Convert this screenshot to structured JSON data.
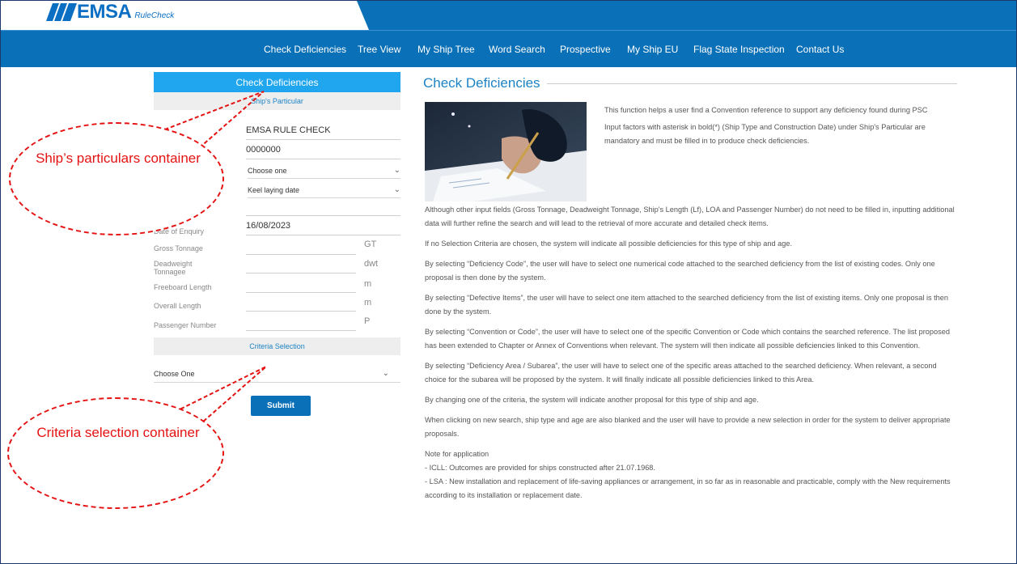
{
  "logo": {
    "text": "EMSA",
    "sub": "RuleCheck"
  },
  "nav": {
    "items": [
      "Check Deficiencies",
      "Tree View",
      "My Ship Tree",
      "Word Search",
      "Prospective",
      "My Ship EU",
      "Flag State Inspection",
      "Contact Us"
    ]
  },
  "left_panel": {
    "title": "Check Deficiencies",
    "ship_particular_header": "Ship's Particular",
    "ship_name": "EMSA RULE CHECK",
    "imo": "0000000",
    "ship_type_placeholder": "Choose one",
    "keel_placeholder": "Keel laying date",
    "date_of_enquiry_label": "Date of Enquiry",
    "date_of_enquiry_value": "16/08/2023",
    "fields": [
      {
        "label": "Gross Tonnage",
        "unit": "GT"
      },
      {
        "label": "Deadweight Tonnagee",
        "unit": "dwt"
      },
      {
        "label": "Freeboard Length",
        "unit": "m"
      },
      {
        "label": "Overall Length",
        "unit": "m"
      },
      {
        "label": "Passenger Number",
        "unit": "P"
      }
    ],
    "criteria_header": "Criteria Selection",
    "criteria_placeholder": "Choose One",
    "submit_label": "Submit"
  },
  "main": {
    "title": "Check Deficiencies",
    "intro": [
      "This function helps a user find a Convention reference to support any deficiency found during PSC",
      "Input factors with asterisk in bold(*) (Ship Type and Construction Date) under Ship's Particular are mandatory and must be filled in to produce check deficiencies."
    ],
    "paragraphs": [
      "Although other input fields (Gross Tonnage, Deadweight Tonnage, Ship's Length (Lf), LOA and Passenger Number) do not need to be filled in, inputting additional data will further refine the search and will lead to the retrieval of more accurate and detailed check items.",
      "If no Selection Criteria are chosen, the system will indicate all possible deficiencies for this type of ship and age.",
      "By selecting “Deficiency Code”, the user will have to select one numerical code attached to the searched deficiency from the list of existing codes. Only one proposal is then done by the system.",
      "By selecting “Defective Items”, the user will have to select one item attached to the searched deficiency from the list of existing items. Only one proposal is then done by the system.",
      "By selecting “Convention or Code”, the user will have to select one of the specific Convention or Code which contains the searched reference. The list proposed has been extended to Chapter or Annex of Conventions when relevant. The system will then indicate all possible deficiencies linked to this Convention.",
      "By selecting “Deficiency Area / Subarea”, the user will have to select one of the specific areas attached to the searched deficiency. When relevant, a second choice for the subarea will be proposed by the system. It will finally indicate all possible deficiencies linked to this Area.",
      "By changing one of the criteria, the system will indicate another proposal for this type of ship and age.",
      "When clicking on new search, ship type and age are also blanked and the user will have to provide a new selection in order for the system to deliver appropriate proposals."
    ],
    "note_title": "Note for application",
    "notes": [
      "- ICLL: Outcomes are provided for ships constructed after 21.07.1968.",
      "- LSA : New installation and replacement of life-saving appliances or arrangement, in so far as in reasonable and practicable, comply with the New requirements according to its installation or replacement date."
    ]
  },
  "annotations": {
    "ship_callout": "Ship’s particulars container",
    "criteria_callout": "Criteria selection container"
  },
  "colors": {
    "nav_blue": "#0a70b7",
    "panel_blue": "#20a6ee",
    "callout_red": "#e51212"
  }
}
